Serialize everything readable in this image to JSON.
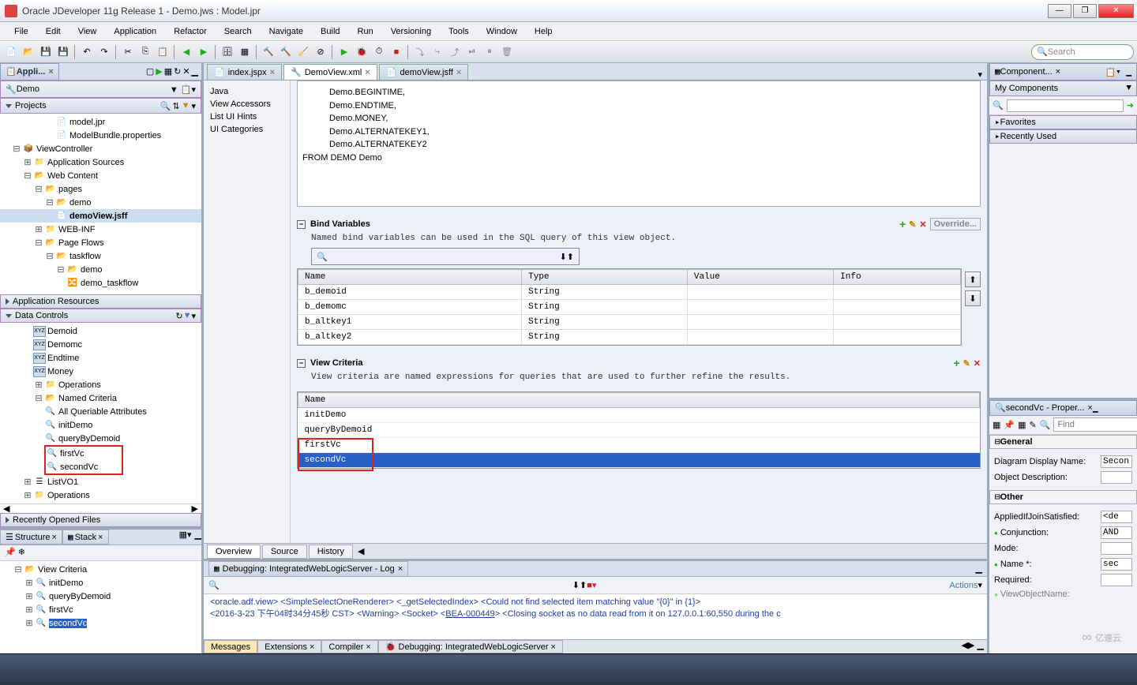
{
  "window": {
    "title": "Oracle JDeveloper 11g Release 1 - Demo.jws : Model.jpr"
  },
  "menu": [
    "File",
    "Edit",
    "View",
    "Application",
    "Refactor",
    "Search",
    "Navigate",
    "Build",
    "Run",
    "Versioning",
    "Tools",
    "Window",
    "Help"
  ],
  "search_placeholder": "Search",
  "app_panel": {
    "tab": "Appli...",
    "project_selector": "Demo",
    "projects_label": "Projects"
  },
  "project_tree": {
    "model_jpr": "model.jpr",
    "model_bundle": "ModelBundle.properties",
    "viewcontroller": "ViewController",
    "app_sources": "Application Sources",
    "web_content": "Web Content",
    "pages": "pages",
    "demo_folder": "demo",
    "demoview_jsff": "demoView.jsff",
    "web_inf": "WEB-INF",
    "page_flows": "Page Flows",
    "taskflow": "taskflow",
    "demo_tf_folder": "demo",
    "demo_taskflow": "demo_taskflow"
  },
  "app_resources": "Application Resources",
  "data_controls": "Data Controls",
  "dc_tree": {
    "demoid": "Demoid",
    "demomc": "Demomc",
    "endtime": "Endtime",
    "money": "Money",
    "operations": "Operations",
    "named_criteria": "Named Criteria",
    "all_queriable": "All Queriable Attributes",
    "initdemo": "initDemo",
    "querybydemoid": "queryByDemoid",
    "firstvc": "firstVc",
    "secondvc": "secondVc",
    "listvo1": "ListVO1",
    "operations2": "Operations"
  },
  "recently_opened": "Recently Opened Files",
  "editor_tabs": [
    {
      "label": "index.jspx",
      "active": false
    },
    {
      "label": "DemoView.xml",
      "active": true
    },
    {
      "label": "demoView.jsff",
      "active": false
    }
  ],
  "side_items": [
    "Java",
    "View Accessors",
    "List UI Hints",
    "UI Categories"
  ],
  "sql_lines": [
    "Demo.BEGINTIME,",
    "Demo.ENDTIME,",
    "Demo.MONEY,",
    "Demo.ALTERNATEKEY1,",
    "Demo.ALTERNATEKEY2"
  ],
  "sql_from": "FROM DEMO Demo",
  "bind_section": {
    "title": "Bind Variables",
    "desc": "Named bind variables can be used in the SQL query of this view object.",
    "override": "Override...",
    "cols": [
      "Name",
      "Type",
      "Value",
      "Info"
    ],
    "rows": [
      {
        "name": "b_demoid",
        "type": "String",
        "value": "",
        "info": ""
      },
      {
        "name": "b_demomc",
        "type": "String",
        "value": "",
        "info": ""
      },
      {
        "name": "b_altkey1",
        "type": "String",
        "value": "",
        "info": ""
      },
      {
        "name": "b_altkey2",
        "type": "String",
        "value": "",
        "info": ""
      }
    ]
  },
  "vc_section": {
    "title": "View Criteria",
    "desc": "View criteria are named expressions for queries that are used to further refine the results.",
    "col": "Name",
    "rows": [
      "initDemo",
      "queryByDemoid",
      "firstVc",
      "secondVc"
    ]
  },
  "bottom_tabs": [
    "Overview",
    "Source",
    "History"
  ],
  "debug": {
    "tab": "Debugging: IntegratedWebLogicServer - Log",
    "actions": "Actions",
    "line1_a": "<oracle.adf.view> <SimpleSelectOneRenderer> <_getSelectedIndex> <Could not find selected item matching value \"{0}\" in {1}>",
    "line2_pre": "<2016-3-23 下午04时34分45秒 CST> <Warning> <Socket> <",
    "line2_link": "BEA-000449",
    "line2_post": "> <Closing socket as no data read from it on 127.0.0.1:60,550 during the c",
    "tabs": [
      "Messages",
      "Extensions",
      "Compiler",
      "Debugging: IntegratedWebLogicServer"
    ]
  },
  "components": {
    "tab": "Component...",
    "my": "My Components",
    "fav": "Favorites",
    "recent": "Recently Used"
  },
  "properties": {
    "title": "secondVc - Proper...",
    "find": "Find",
    "general": "General",
    "diag_name_lbl": "Diagram Display Name:",
    "diag_name_val": "Secon",
    "obj_desc_lbl": "Object Description:",
    "other": "Other",
    "applied_lbl": "AppliedIfJoinSatisfied:",
    "applied_val": "<de",
    "conj_lbl": "Conjunction:",
    "conj_val": "AND",
    "mode_lbl": "Mode:",
    "name_lbl": "Name *:",
    "name_val": "sec",
    "req_lbl": "Required:",
    "view_obj_lbl": "ViewObjectName:"
  },
  "structure": {
    "tab": "Structure",
    "stack": "Stack",
    "root": "View Criteria",
    "items": [
      "initDemo",
      "queryByDemoid",
      "firstVc",
      "secondVc"
    ]
  },
  "watermark": "亿速云"
}
